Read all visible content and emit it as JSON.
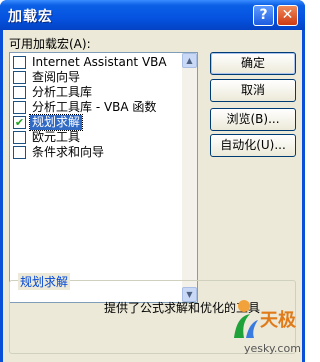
{
  "window": {
    "title": "加载宏",
    "help_glyph": "?",
    "close_glyph": "✕"
  },
  "addins": {
    "label": "可用加载宏(A):",
    "items": [
      {
        "label": "Internet Assistant VBA",
        "checked": false
      },
      {
        "label": "查阅向导",
        "checked": false
      },
      {
        "label": "分析工具库",
        "checked": false
      },
      {
        "label": "分析工具库 - VBA 函数",
        "checked": false
      },
      {
        "label": "规划求解",
        "checked": true,
        "selected": true
      },
      {
        "label": "欧元工具",
        "checked": false
      },
      {
        "label": "条件求和向导",
        "checked": false
      }
    ]
  },
  "buttons": {
    "ok": "确定",
    "cancel": "取消",
    "browse": "浏览(B)...",
    "automation": "自动化(U)..."
  },
  "description": {
    "title": "规划求解",
    "text": "提供了公式求解和优化的工具"
  },
  "watermark": {
    "brand": "天极",
    "site": "yesky.com"
  },
  "colors": {
    "titlebar": "#0553e0",
    "selection": "#316ac5",
    "dialog_bg": "#ece9d8"
  }
}
